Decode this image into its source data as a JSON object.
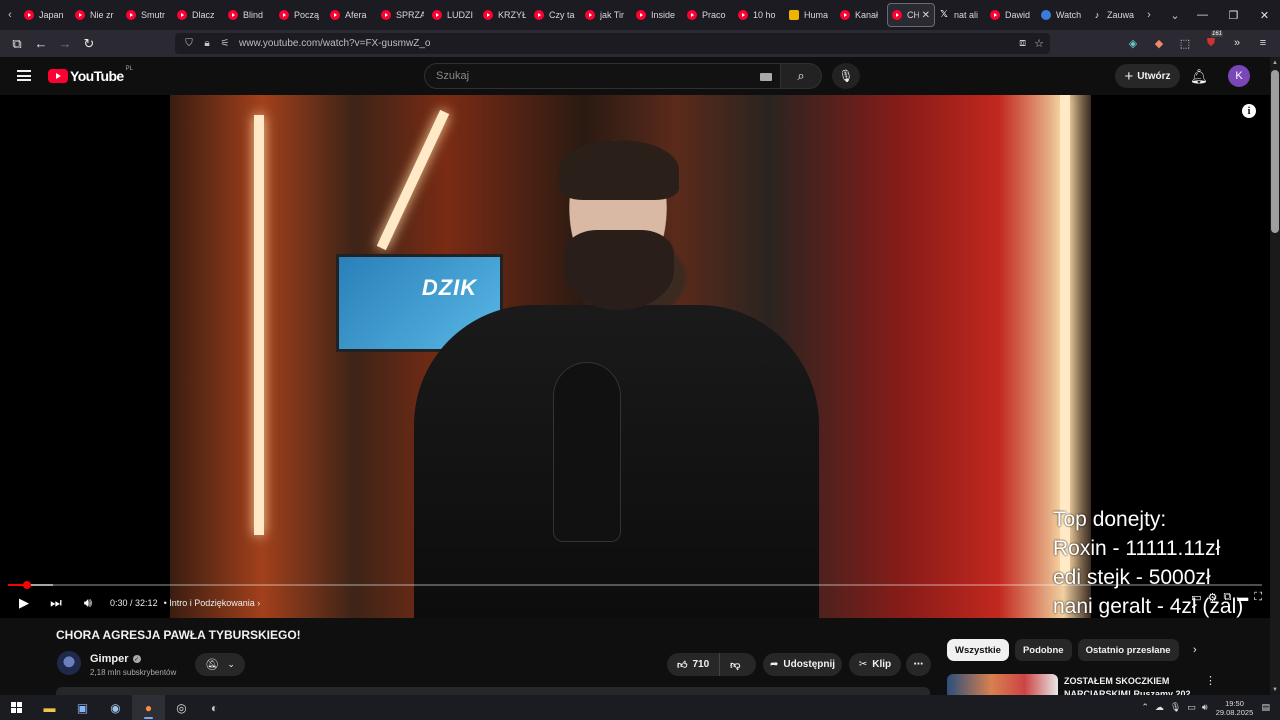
{
  "browser": {
    "tabs": [
      {
        "label": "Japan",
        "icon": "youtube-icon"
      },
      {
        "label": "Nie zr",
        "icon": "youtube-icon"
      },
      {
        "label": "Smutr",
        "icon": "youtube-icon"
      },
      {
        "label": "Dlacz",
        "icon": "youtube-icon"
      },
      {
        "label": "Blind",
        "icon": "youtube-icon"
      },
      {
        "label": "Począ",
        "icon": "youtube-icon"
      },
      {
        "label": "Afera",
        "icon": "youtube-icon"
      },
      {
        "label": "SPRZĄ",
        "icon": "youtube-icon"
      },
      {
        "label": "LUDZI",
        "icon": "youtube-icon"
      },
      {
        "label": "KRZYŁ",
        "icon": "youtube-icon"
      },
      {
        "label": "Czy ta",
        "icon": "youtube-icon"
      },
      {
        "label": "jak Tir",
        "icon": "youtube-icon"
      },
      {
        "label": "Inside",
        "icon": "youtube-icon"
      },
      {
        "label": "Praco",
        "icon": "youtube-icon"
      },
      {
        "label": "10 ho",
        "icon": "youtube-icon"
      },
      {
        "label": "Huma",
        "icon": "bookmark-icon"
      },
      {
        "label": "Kanał",
        "icon": "youtube-icon"
      },
      {
        "label": "CH",
        "icon": "youtube-icon",
        "active": true
      },
      {
        "label": "nat ali",
        "icon": "x-icon"
      },
      {
        "label": "Dawid",
        "icon": "youtube-icon"
      },
      {
        "label": "Watch",
        "icon": "globe-icon"
      },
      {
        "label": "Zauwa",
        "icon": "tiktok-icon"
      }
    ],
    "url": "www.youtube.com/watch?v=FX-gusmwZ_o",
    "extensions_badge": "161"
  },
  "youtube": {
    "logo_text": "YouTube",
    "region": "PL",
    "search_placeholder": "Szukaj",
    "create_label": "Utwórz",
    "avatar_letter": "K"
  },
  "player": {
    "current_time": "0:30",
    "duration": "32:12",
    "chapter": "Intro i Podziękowania",
    "progress_fraction": 0.0155,
    "buffered_fraction": 0.036,
    "overlay_lines": [
      "Top donejty:",
      "Roxin - 11111.11zł",
      "edi stejk - 5000zł",
      "nani geralt - 4zł (żal)"
    ],
    "poster_text": "DZIK"
  },
  "video": {
    "title": "CHORA AGRESJA PAWŁA TYBURSKIEGO!",
    "channel": "Gimper",
    "subscribers": "2,18 mln subskrybentów",
    "likes": "710",
    "share_label": "Udostępnij",
    "clip_label": "Klip"
  },
  "sidebar": {
    "chips": [
      "Wszystkie",
      "Podobne",
      "Ostatnio przesłane"
    ],
    "recommended_title": "ZOSTAŁEM SKOCZKIEM NARCIARSKIM! Ruszamy 202"
  },
  "taskbar": {
    "time": "19:50",
    "date": "29.08.2025"
  }
}
